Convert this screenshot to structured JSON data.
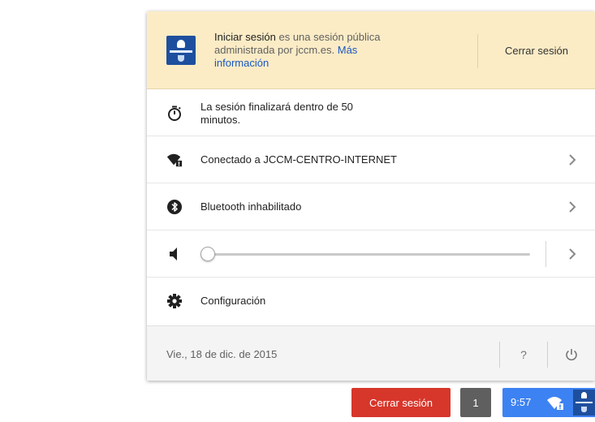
{
  "header": {
    "title": "Iniciar sesión",
    "desc": " es una sesión pública administrada por jccm.es. ",
    "more_link": "Más información",
    "signout_label": "Cerrar sesión"
  },
  "rows": {
    "timer": {
      "label": "La sesión finalizará dentro de 50 minutos.",
      "icon": "timer-icon"
    },
    "network": {
      "label": "Conectado a JCCM-CENTRO-INTERNET",
      "icon": "wifi-icon"
    },
    "bluetooth": {
      "label": "Bluetooth inhabilitado",
      "icon": "bluetooth-icon"
    },
    "volume": {
      "icon": "speaker-icon",
      "level": 0
    },
    "settings": {
      "label": "Configuración",
      "icon": "gear-icon"
    }
  },
  "footer": {
    "date": "Vie., 18 de dic. de 2015",
    "help_label": "?",
    "power_icon": "power-icon"
  },
  "shelf": {
    "signout_label": "Cerrar sesión",
    "window_count": "1",
    "time": "9:57"
  },
  "colors": {
    "header_bg": "#fbecc6",
    "link": "#1a57c2",
    "signout_red": "#d7362b",
    "status_blue": "#3d82f2"
  }
}
